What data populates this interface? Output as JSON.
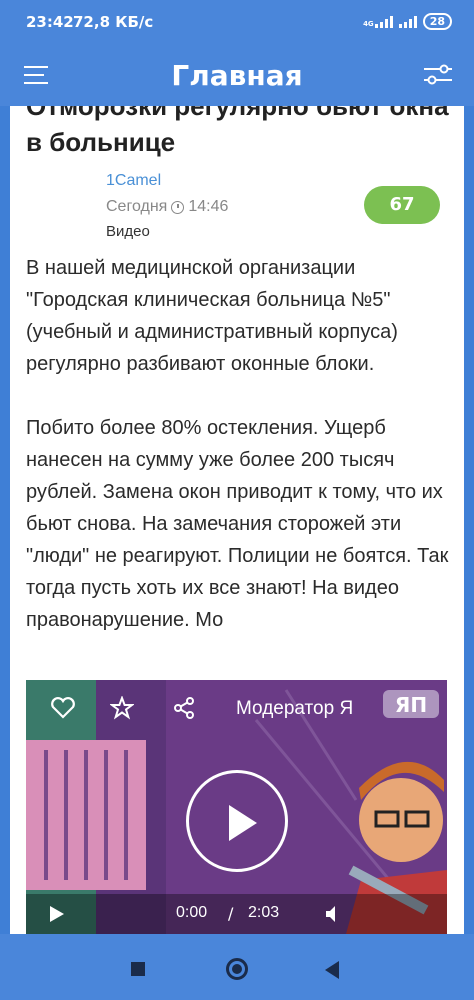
{
  "status_bar": {
    "time": "23:42",
    "speed": "72,8 КБ/с",
    "network": "4G",
    "battery": "28"
  },
  "app_bar": {
    "title": "Главная",
    "menu_icon": "hamburger-icon",
    "filter_icon": "filter-sliders-icon"
  },
  "post": {
    "title": "Отморозки регулярно бьют окна в больнице",
    "author": "1Camel",
    "time": "Сегодня",
    "time_value": "14:46",
    "category": "Видео",
    "rating": "67",
    "paragraphs": [
      "В нашей медицинской организации \"Городская клиническая больница №5\" (учебный и административный корпуса) регулярно разбивают оконные блоки.",
      "Побито более 80% остекления. Ущерб нанесен на сумму уже более 200 тысяч рублей. Замена окон приводит к тому, что их бьют снова. На замечания сторожей эти \"люди\" не реагируют. Полиции не боятся. Так тогда пусть хоть их все знают! На видео правонарушение. Мо"
    ]
  },
  "video": {
    "title": "Модератор Я",
    "current_time": "0:00",
    "separator": "/",
    "duration": "2:03"
  },
  "colors": {
    "primary": "#4a86da",
    "rating_bg": "#7cc052",
    "author": "#4a90d6"
  }
}
